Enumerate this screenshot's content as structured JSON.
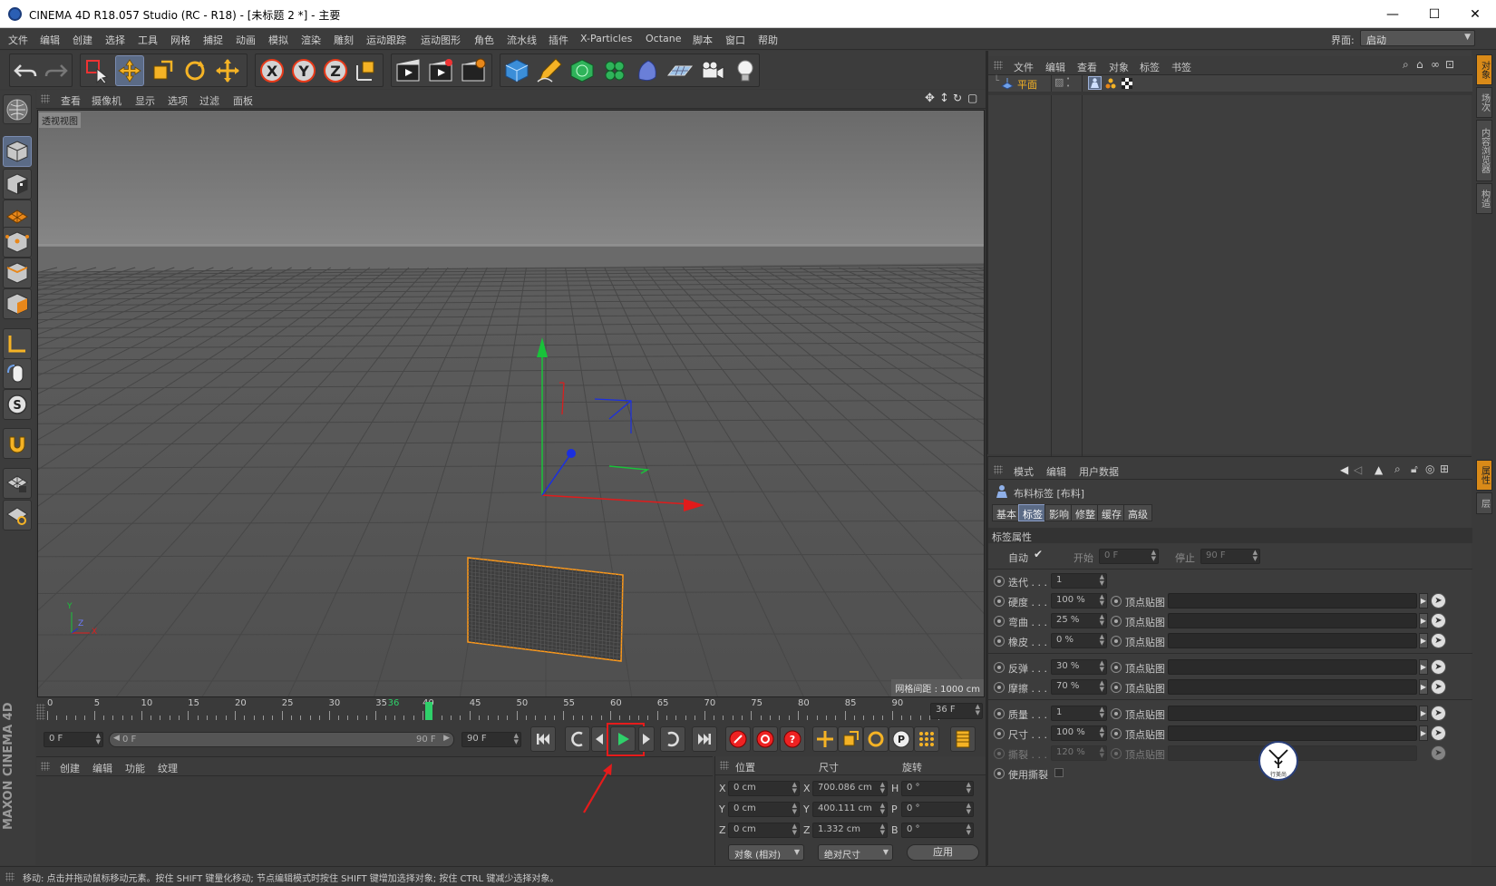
{
  "window": {
    "title": "CINEMA 4D R18.057 Studio (RC - R18) - [未标题 2 *] - 主要",
    "minimize": "—",
    "maximize": "☐",
    "close": "✕"
  },
  "menu": {
    "items": [
      "文件",
      "编辑",
      "创建",
      "选择",
      "工具",
      "网格",
      "捕捉",
      "动画",
      "模拟",
      "渲染",
      "雕刻",
      "运动跟踪",
      "运动图形",
      "角色",
      "流水线",
      "插件",
      "X-Particles",
      "Octane",
      "脚本",
      "窗口",
      "帮助"
    ],
    "layout_label": "界面:",
    "layout_value": "启动"
  },
  "viewport": {
    "menu": [
      "查看",
      "摄像机",
      "显示",
      "选项",
      "过滤",
      "面板"
    ],
    "view_name": "透视视图",
    "grid_spacing": "网格间距 : 1000 cm",
    "axis_y": "Y",
    "axis_z": "Z",
    "axis_x": "X"
  },
  "timeline": {
    "ticks": [
      "0",
      "5",
      "10",
      "15",
      "20",
      "25",
      "30",
      "35",
      "36",
      "40",
      "45",
      "50",
      "55",
      "60",
      "65",
      "70",
      "75",
      "80",
      "85",
      "90"
    ],
    "current_frame": "36 F",
    "start_field": "0 F",
    "range_start": "0 F",
    "range_end": "90 F",
    "end_field": "90 F"
  },
  "material_panel": {
    "menu": [
      "创建",
      "编辑",
      "功能",
      "纹理"
    ]
  },
  "coords": {
    "headers": [
      "位置",
      "尺寸",
      "旋转"
    ],
    "rows": [
      {
        "axis": "X",
        "pos": "0 cm",
        "size_axis": "X",
        "size": "700.086 cm",
        "rot_axis": "H",
        "rot": "0 °"
      },
      {
        "axis": "Y",
        "pos": "0 cm",
        "size_axis": "Y",
        "size": "400.111 cm",
        "rot_axis": "P",
        "rot": "0 °"
      },
      {
        "axis": "Z",
        "pos": "0 cm",
        "size_axis": "Z",
        "size": "1.332 cm",
        "rot_axis": "B",
        "rot": "0 °"
      }
    ],
    "mode_dropdown": "对象 (相对)",
    "size_dropdown": "绝对尺寸",
    "apply": "应用"
  },
  "object_manager": {
    "menu": [
      "文件",
      "编辑",
      "查看",
      "对象",
      "标签",
      "书签"
    ],
    "object_name": "平面"
  },
  "attributes": {
    "menu": [
      "模式",
      "编辑",
      "用户数据"
    ],
    "tag_title": "布料标签 [布料]",
    "tabs": [
      "基本",
      "标签",
      "影响",
      "修整",
      "缓存",
      "高级"
    ],
    "section": "标签属性",
    "auto_label": "自动",
    "start_label": "开始",
    "start_value": "0 F",
    "stop_label": "停止",
    "stop_value": "90 F",
    "params": [
      {
        "label": "迭代 . . .",
        "value": "1",
        "map": ""
      },
      {
        "label": "硬度 . . .",
        "value": "100 %",
        "map": "顶点贴图"
      },
      {
        "label": "弯曲 . . .",
        "value": "25 %",
        "map": "顶点贴图"
      },
      {
        "label": "橡皮 . . .",
        "value": "0 %",
        "map": "顶点贴图"
      },
      {
        "label": "反弹 . . .",
        "value": "30 %",
        "map": "顶点贴图"
      },
      {
        "label": "摩擦 . . .",
        "value": "70 %",
        "map": "顶点贴图"
      },
      {
        "label": "质量 . . .",
        "value": "1",
        "map": "顶点贴图"
      },
      {
        "label": "尺寸 . . .",
        "value": "100 %",
        "map": "顶点贴图"
      },
      {
        "label": "撕裂 . . .",
        "value": "120 %",
        "map": "顶点贴图"
      }
    ],
    "use_tear": "使用撕裂",
    "watermark": "行美尚"
  },
  "right_tabs": [
    "对象",
    "场次",
    "内容浏览器",
    "构造"
  ],
  "right_tabs2": [
    "属性",
    "层"
  ],
  "left_brand": "MAXON CINEMA 4D",
  "status": "移动: 点击并拖动鼠标移动元素。按住 SHIFT 键量化移动; 节点编辑模式时按住 SHIFT 键增加选择对象; 按住 CTRL 键减少选择对象。"
}
